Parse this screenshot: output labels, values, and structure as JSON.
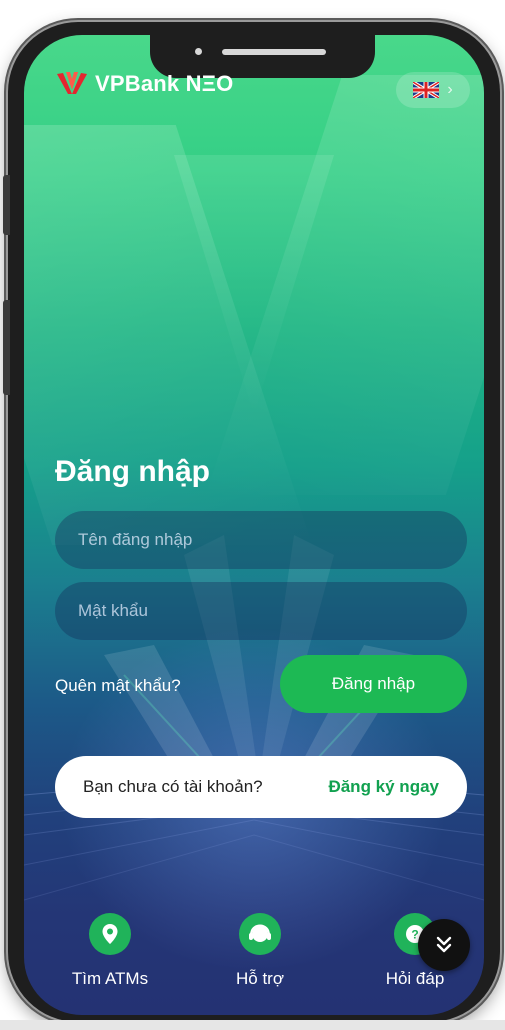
{
  "app": {
    "brand_name": "VPBank NΞO"
  },
  "header": {
    "language_icon": "uk-flag-icon"
  },
  "login": {
    "title": "Đăng nhập",
    "username_placeholder": "Tên đăng nhập",
    "password_placeholder": "Mật khẩu",
    "forgot_password": "Quên mật khẩu?",
    "login_button": "Đăng nhập"
  },
  "signup": {
    "question": "Bạn chưa có tài khoản?",
    "link": "Đăng ký ngay"
  },
  "bottom_nav": [
    {
      "label": "Tìm ATMs",
      "icon": "location-pin-icon"
    },
    {
      "label": "Hỗ trợ",
      "icon": "headset-icon"
    },
    {
      "label": "Hỏi đáp",
      "icon": "question-icon"
    }
  ],
  "colors": {
    "accent_green": "#1db954",
    "link_green": "#12a150",
    "brand_red": "#e4262f"
  }
}
